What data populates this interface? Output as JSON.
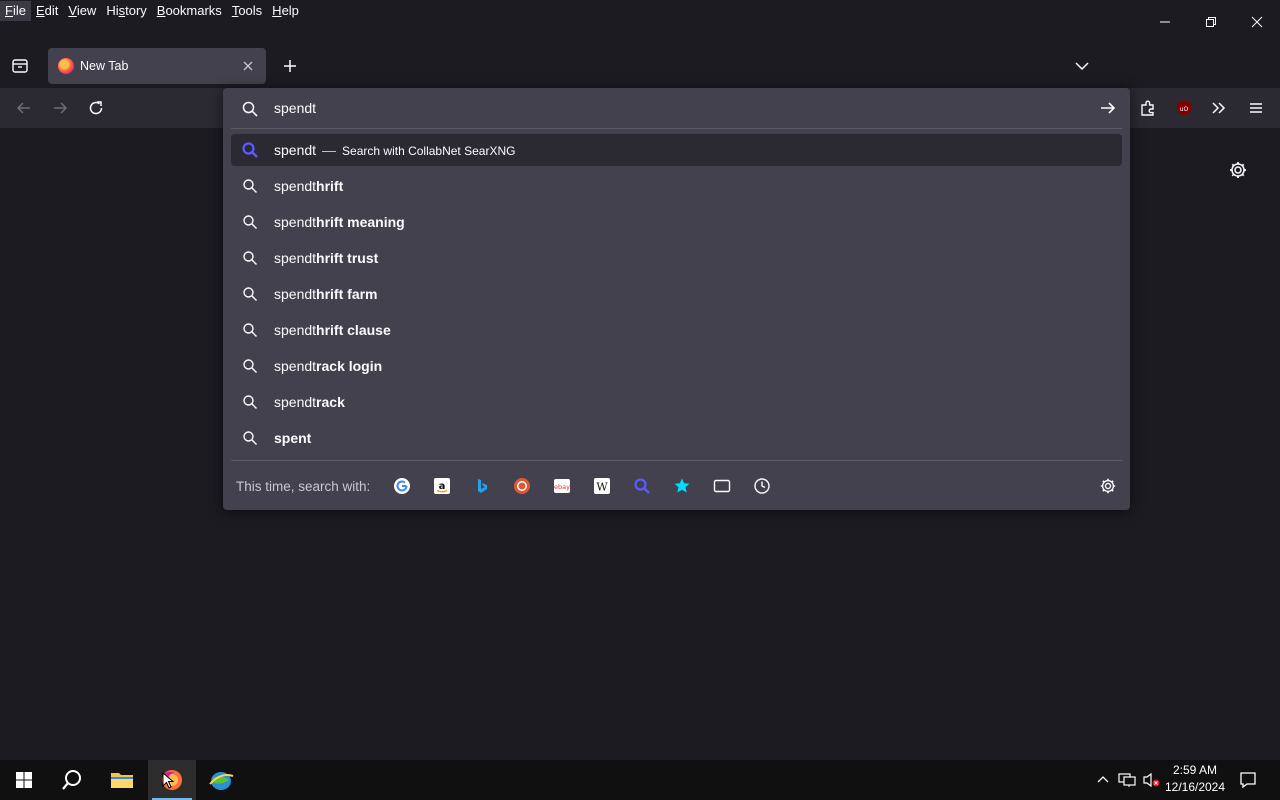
{
  "menu": [
    {
      "pre": "",
      "u": "F",
      "post": "ile"
    },
    {
      "pre": "",
      "u": "E",
      "post": "dit"
    },
    {
      "pre": "",
      "u": "V",
      "post": "iew"
    },
    {
      "pre": "Hi",
      "u": "s",
      "post": "tory"
    },
    {
      "pre": "",
      "u": "B",
      "post": "ookmarks"
    },
    {
      "pre": "",
      "u": "T",
      "post": "ools"
    },
    {
      "pre": "",
      "u": "H",
      "post": "elp"
    }
  ],
  "tab": {
    "title": "New Tab"
  },
  "urlbar": {
    "query": "spendt",
    "first_result": {
      "text": "spendt",
      "action": "Search with CollabNet SearXNG",
      "dash": "—"
    },
    "suggestions": [
      {
        "prefix": "spendt",
        "bold": "hrift"
      },
      {
        "prefix": "spendt",
        "bold": "hrift meaning"
      },
      {
        "prefix": "spendt",
        "bold": "hrift trust"
      },
      {
        "prefix": "spendt",
        "bold": "hrift farm"
      },
      {
        "prefix": "spendt",
        "bold": "hrift clause"
      },
      {
        "prefix": "spendt",
        "bold": "rack login"
      },
      {
        "prefix": "spendt",
        "bold": "rack"
      },
      {
        "prefix": "",
        "bold": "spent"
      }
    ],
    "oneoff_label": "This time, search with:",
    "engines": [
      "google-icon",
      "amazon-icon",
      "bing-icon",
      "duckduckgo-icon",
      "ebay-icon",
      "wikipedia-icon",
      "searxng-icon",
      "bookmarks-icon",
      "tabs-icon",
      "history-icon"
    ]
  },
  "clock": {
    "time": "2:59 AM",
    "date": "12/16/2024"
  },
  "colors": {
    "accent": "#5b5bff",
    "panel": "#42414d",
    "chrome": "#2b2a33",
    "bg": "#1c1b22"
  }
}
